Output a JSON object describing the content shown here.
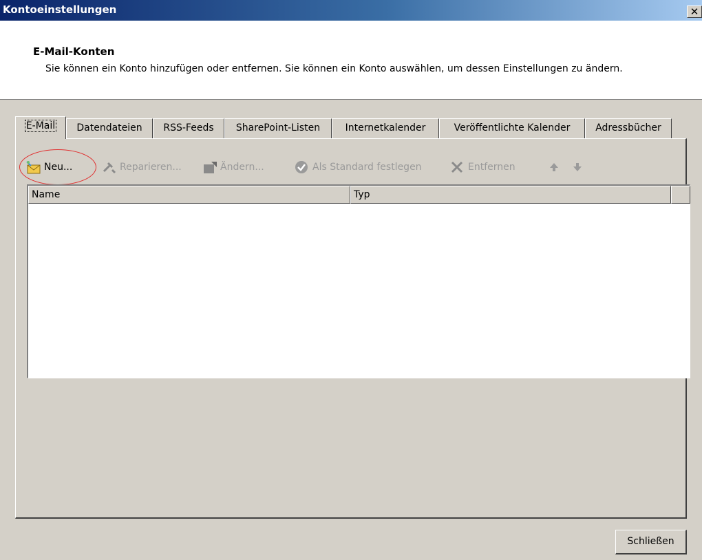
{
  "window": {
    "title": "Kontoeinstellungen",
    "close_glyph": "✕"
  },
  "header": {
    "heading": "E-Mail-Konten",
    "description": "Sie können ein Konto hinzufügen oder entfernen. Sie können ein Konto auswählen, um dessen Einstellungen zu ändern."
  },
  "tabs": [
    {
      "label": "E-Mail",
      "active": true
    },
    {
      "label": "Datendateien"
    },
    {
      "label": "RSS-Feeds"
    },
    {
      "label": "SharePoint-Listen"
    },
    {
      "label": "Internetkalender"
    },
    {
      "label": "Veröffentlichte Kalender"
    },
    {
      "label": "Adressbücher"
    }
  ],
  "toolbar": {
    "new_label": "Neu...",
    "repair_label": "Reparieren...",
    "change_label": "Ändern...",
    "default_label": "Als Standard festlegen",
    "remove_label": "Entfernen",
    "up_icon": "arrow-up-icon",
    "down_icon": "arrow-down-icon"
  },
  "list": {
    "columns": [
      "Name",
      "Typ"
    ],
    "rows": []
  },
  "footer": {
    "close_label": "Schließen"
  }
}
